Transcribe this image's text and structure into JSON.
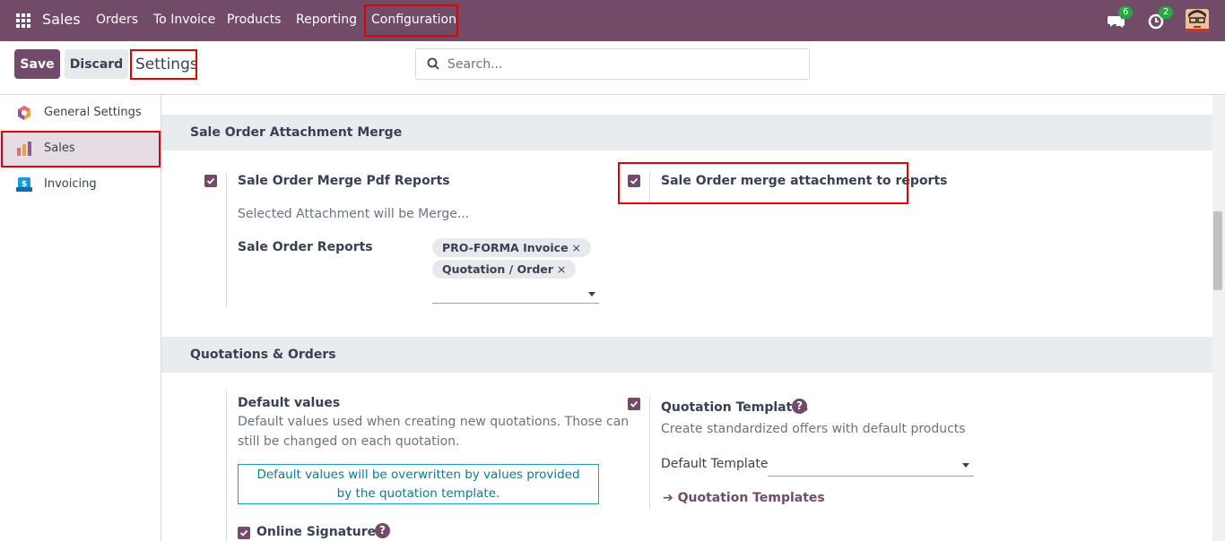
{
  "navbar": {
    "brand": "Sales",
    "menu": [
      "Orders",
      "To Invoice",
      "Products",
      "Reporting",
      "Configuration"
    ],
    "messages_count": "6",
    "activities_count": "2",
    "bg_color": "#714B67"
  },
  "control": {
    "save_label": "Save",
    "discard_label": "Discard",
    "title": "Settings",
    "search_placeholder": "Search..."
  },
  "sidebar": {
    "items": [
      {
        "label": "General Settings",
        "icon": "odoo-logo-icon"
      },
      {
        "label": "Sales",
        "icon": "sales-chart-icon",
        "active": true
      },
      {
        "label": "Invoicing",
        "icon": "invoice-icon"
      }
    ]
  },
  "section1": {
    "title": "Sale Order Attachment Merge",
    "merge_pdf_label": "Sale Order Merge Pdf Reports",
    "merge_pdf_checked": true,
    "merge_pdf_desc": "Selected Attachment will be Merge...",
    "reports_label": "Sale Order Reports",
    "report_tags": [
      "PRO-FORMA Invoice",
      "Quotation / Order"
    ],
    "merge_attach_label": "Sale Order merge attachment to reports",
    "merge_attach_checked": true
  },
  "section2": {
    "title": "Quotations & Orders",
    "default_values_label": "Default values",
    "default_values_desc1": "Default values used when creating new quotations. Those can",
    "default_values_desc2": "still be changed on each quotation.",
    "note_line1": "Default values will be overwritten by values provided",
    "note_line2": "by the quotation template.",
    "templates_label": "Quotation Templates",
    "templates_checked": true,
    "templates_desc": "Create standardized offers with default products",
    "default_template_label": "Default Template",
    "templates_link": "Quotation Templates",
    "online_signature_label": "Online Signature",
    "online_signature_checked": true
  }
}
